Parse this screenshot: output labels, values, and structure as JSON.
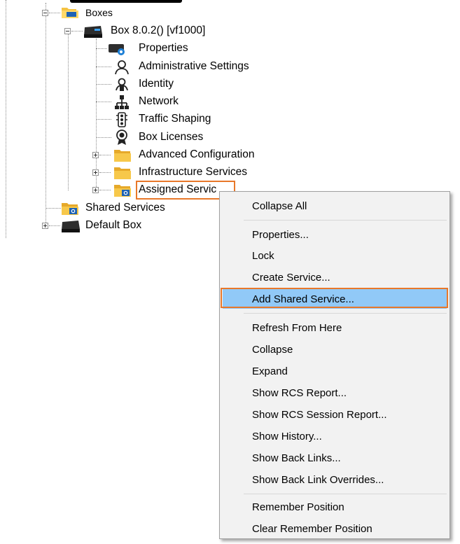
{
  "tree": {
    "boxes_label": "Boxes",
    "box_label": "Box 8.0.2() [vf1000]",
    "children": {
      "properties": "Properties",
      "admin_settings": "Administrative Settings",
      "identity": "Identity",
      "network": "Network",
      "traffic_shaping": "Traffic Shaping",
      "box_licenses": "Box Licenses",
      "advanced_configuration": "Advanced Configuration",
      "infrastructure_services": "Infrastructure Services",
      "assigned_services": "Assigned Servic"
    },
    "shared_services": "Shared Services",
    "default_box": "Default Box"
  },
  "context_menu": {
    "items": [
      "Collapse All",
      "Properties...",
      "Lock",
      "Create Service...",
      "Add Shared Service...",
      "Refresh From Here",
      "Collapse",
      "Expand",
      "Show RCS Report...",
      "Show RCS Session Report...",
      "Show History...",
      "Show Back Links...",
      "Show Back Link Overrides...",
      "Remember Position",
      "Clear Remember Position"
    ],
    "highlighted": "Add Shared Service..."
  },
  "colors": {
    "highlight": "#91c9f7",
    "annotation_frame": "#e8782a",
    "folder": "#f5c342"
  },
  "icons": {
    "boxes": "folder-box-icon",
    "box": "box-icon",
    "properties": "properties-gear-icon",
    "admin_settings": "person-icon",
    "identity": "identity-badge-icon",
    "network": "network-icon",
    "traffic_shaping": "traffic-light-icon",
    "box_licenses": "license-seal-icon",
    "folder": "folder-icon",
    "assigned_services": "folder-service-icon",
    "shared_services": "folder-service-icon",
    "default_box": "box-icon"
  }
}
